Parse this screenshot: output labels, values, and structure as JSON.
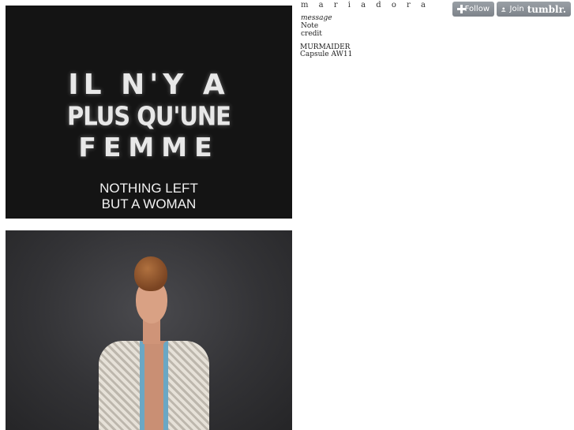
{
  "post1": {
    "french_lines": [
      "IL N'Y A",
      "PLUS QU'UNE",
      "FEMME"
    ],
    "english_lines": [
      "NOTHING LEFT",
      "BUT A WOMAN"
    ]
  },
  "post2": {
    "image": "fashion-model-photo"
  },
  "sidebar": {
    "title": "m a r i a   d o r a",
    "links": [
      "message",
      "Note",
      "credit"
    ],
    "description_lines": [
      "MURMAIDER",
      "Capsule AW11"
    ]
  },
  "toolbar": {
    "follow_label": "Follow",
    "join_label": "Join",
    "brand_label": "tumblr."
  },
  "colors": {
    "button_bg": "#8a9096",
    "post_bg": "#141414",
    "vest_trim": "#6aa7c4"
  },
  "icons": [
    "plus-icon",
    "user-icon"
  ]
}
